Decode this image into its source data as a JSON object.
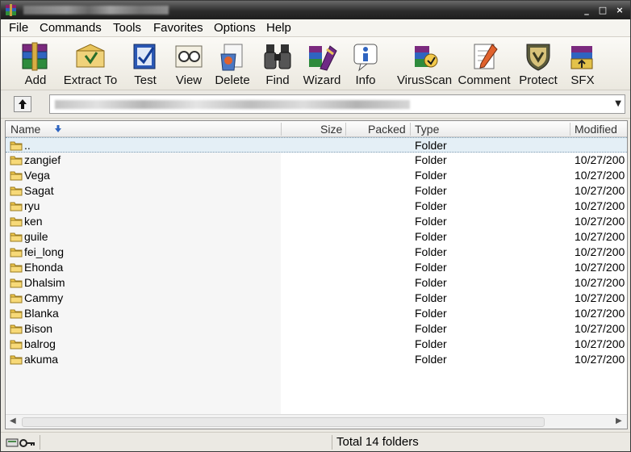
{
  "window": {
    "controls": {
      "minimize": "_",
      "maximize": "□",
      "close": "×"
    }
  },
  "menu": [
    "File",
    "Commands",
    "Tools",
    "Favorites",
    "Options",
    "Help"
  ],
  "toolbar": [
    {
      "label": "Add",
      "icon": "add-archive-icon"
    },
    {
      "label": "Extract To",
      "icon": "extract-to-icon"
    },
    {
      "label": "Test",
      "icon": "test-icon"
    },
    {
      "label": "View",
      "icon": "view-icon"
    },
    {
      "label": "Delete",
      "icon": "delete-icon"
    },
    {
      "label": "Find",
      "icon": "find-binoculars-icon"
    },
    {
      "label": "Wizard",
      "icon": "wizard-icon"
    },
    {
      "label": "Info",
      "icon": "info-icon"
    },
    {
      "label": "VirusScan",
      "icon": "virusscan-icon"
    },
    {
      "label": "Comment",
      "icon": "comment-icon"
    },
    {
      "label": "Protect",
      "icon": "protect-shield-icon"
    },
    {
      "label": "SFX",
      "icon": "sfx-icon"
    }
  ],
  "columns": {
    "name": "Name",
    "size": "Size",
    "packed": "Packed",
    "type": "Type",
    "modified": "Modified"
  },
  "rows": [
    {
      "name": "..",
      "size": "",
      "packed": "",
      "type": "Folder",
      "modified": "",
      "selected": true
    },
    {
      "name": "zangief",
      "size": "",
      "packed": "",
      "type": "Folder",
      "modified": "10/27/200"
    },
    {
      "name": "Vega",
      "size": "",
      "packed": "",
      "type": "Folder",
      "modified": "10/27/200"
    },
    {
      "name": "Sagat",
      "size": "",
      "packed": "",
      "type": "Folder",
      "modified": "10/27/200"
    },
    {
      "name": "ryu",
      "size": "",
      "packed": "",
      "type": "Folder",
      "modified": "10/27/200"
    },
    {
      "name": "ken",
      "size": "",
      "packed": "",
      "type": "Folder",
      "modified": "10/27/200"
    },
    {
      "name": "guile",
      "size": "",
      "packed": "",
      "type": "Folder",
      "modified": "10/27/200"
    },
    {
      "name": "fei_long",
      "size": "",
      "packed": "",
      "type": "Folder",
      "modified": "10/27/200"
    },
    {
      "name": "Ehonda",
      "size": "",
      "packed": "",
      "type": "Folder",
      "modified": "10/27/200"
    },
    {
      "name": "Dhalsim",
      "size": "",
      "packed": "",
      "type": "Folder",
      "modified": "10/27/200"
    },
    {
      "name": "Cammy",
      "size": "",
      "packed": "",
      "type": "Folder",
      "modified": "10/27/200"
    },
    {
      "name": "Blanka",
      "size": "",
      "packed": "",
      "type": "Folder",
      "modified": "10/27/200"
    },
    {
      "name": "Bison",
      "size": "",
      "packed": "",
      "type": "Folder",
      "modified": "10/27/200"
    },
    {
      "name": "balrog",
      "size": "",
      "packed": "",
      "type": "Folder",
      "modified": "10/27/200"
    },
    {
      "name": "akuma",
      "size": "",
      "packed": "",
      "type": "Folder",
      "modified": "10/27/200"
    }
  ],
  "status": {
    "summary": "Total 14 folders"
  },
  "colors": {
    "selection": "#e4eff6",
    "folder": "#f2c94c",
    "titlebar": "#2c2c2c"
  }
}
